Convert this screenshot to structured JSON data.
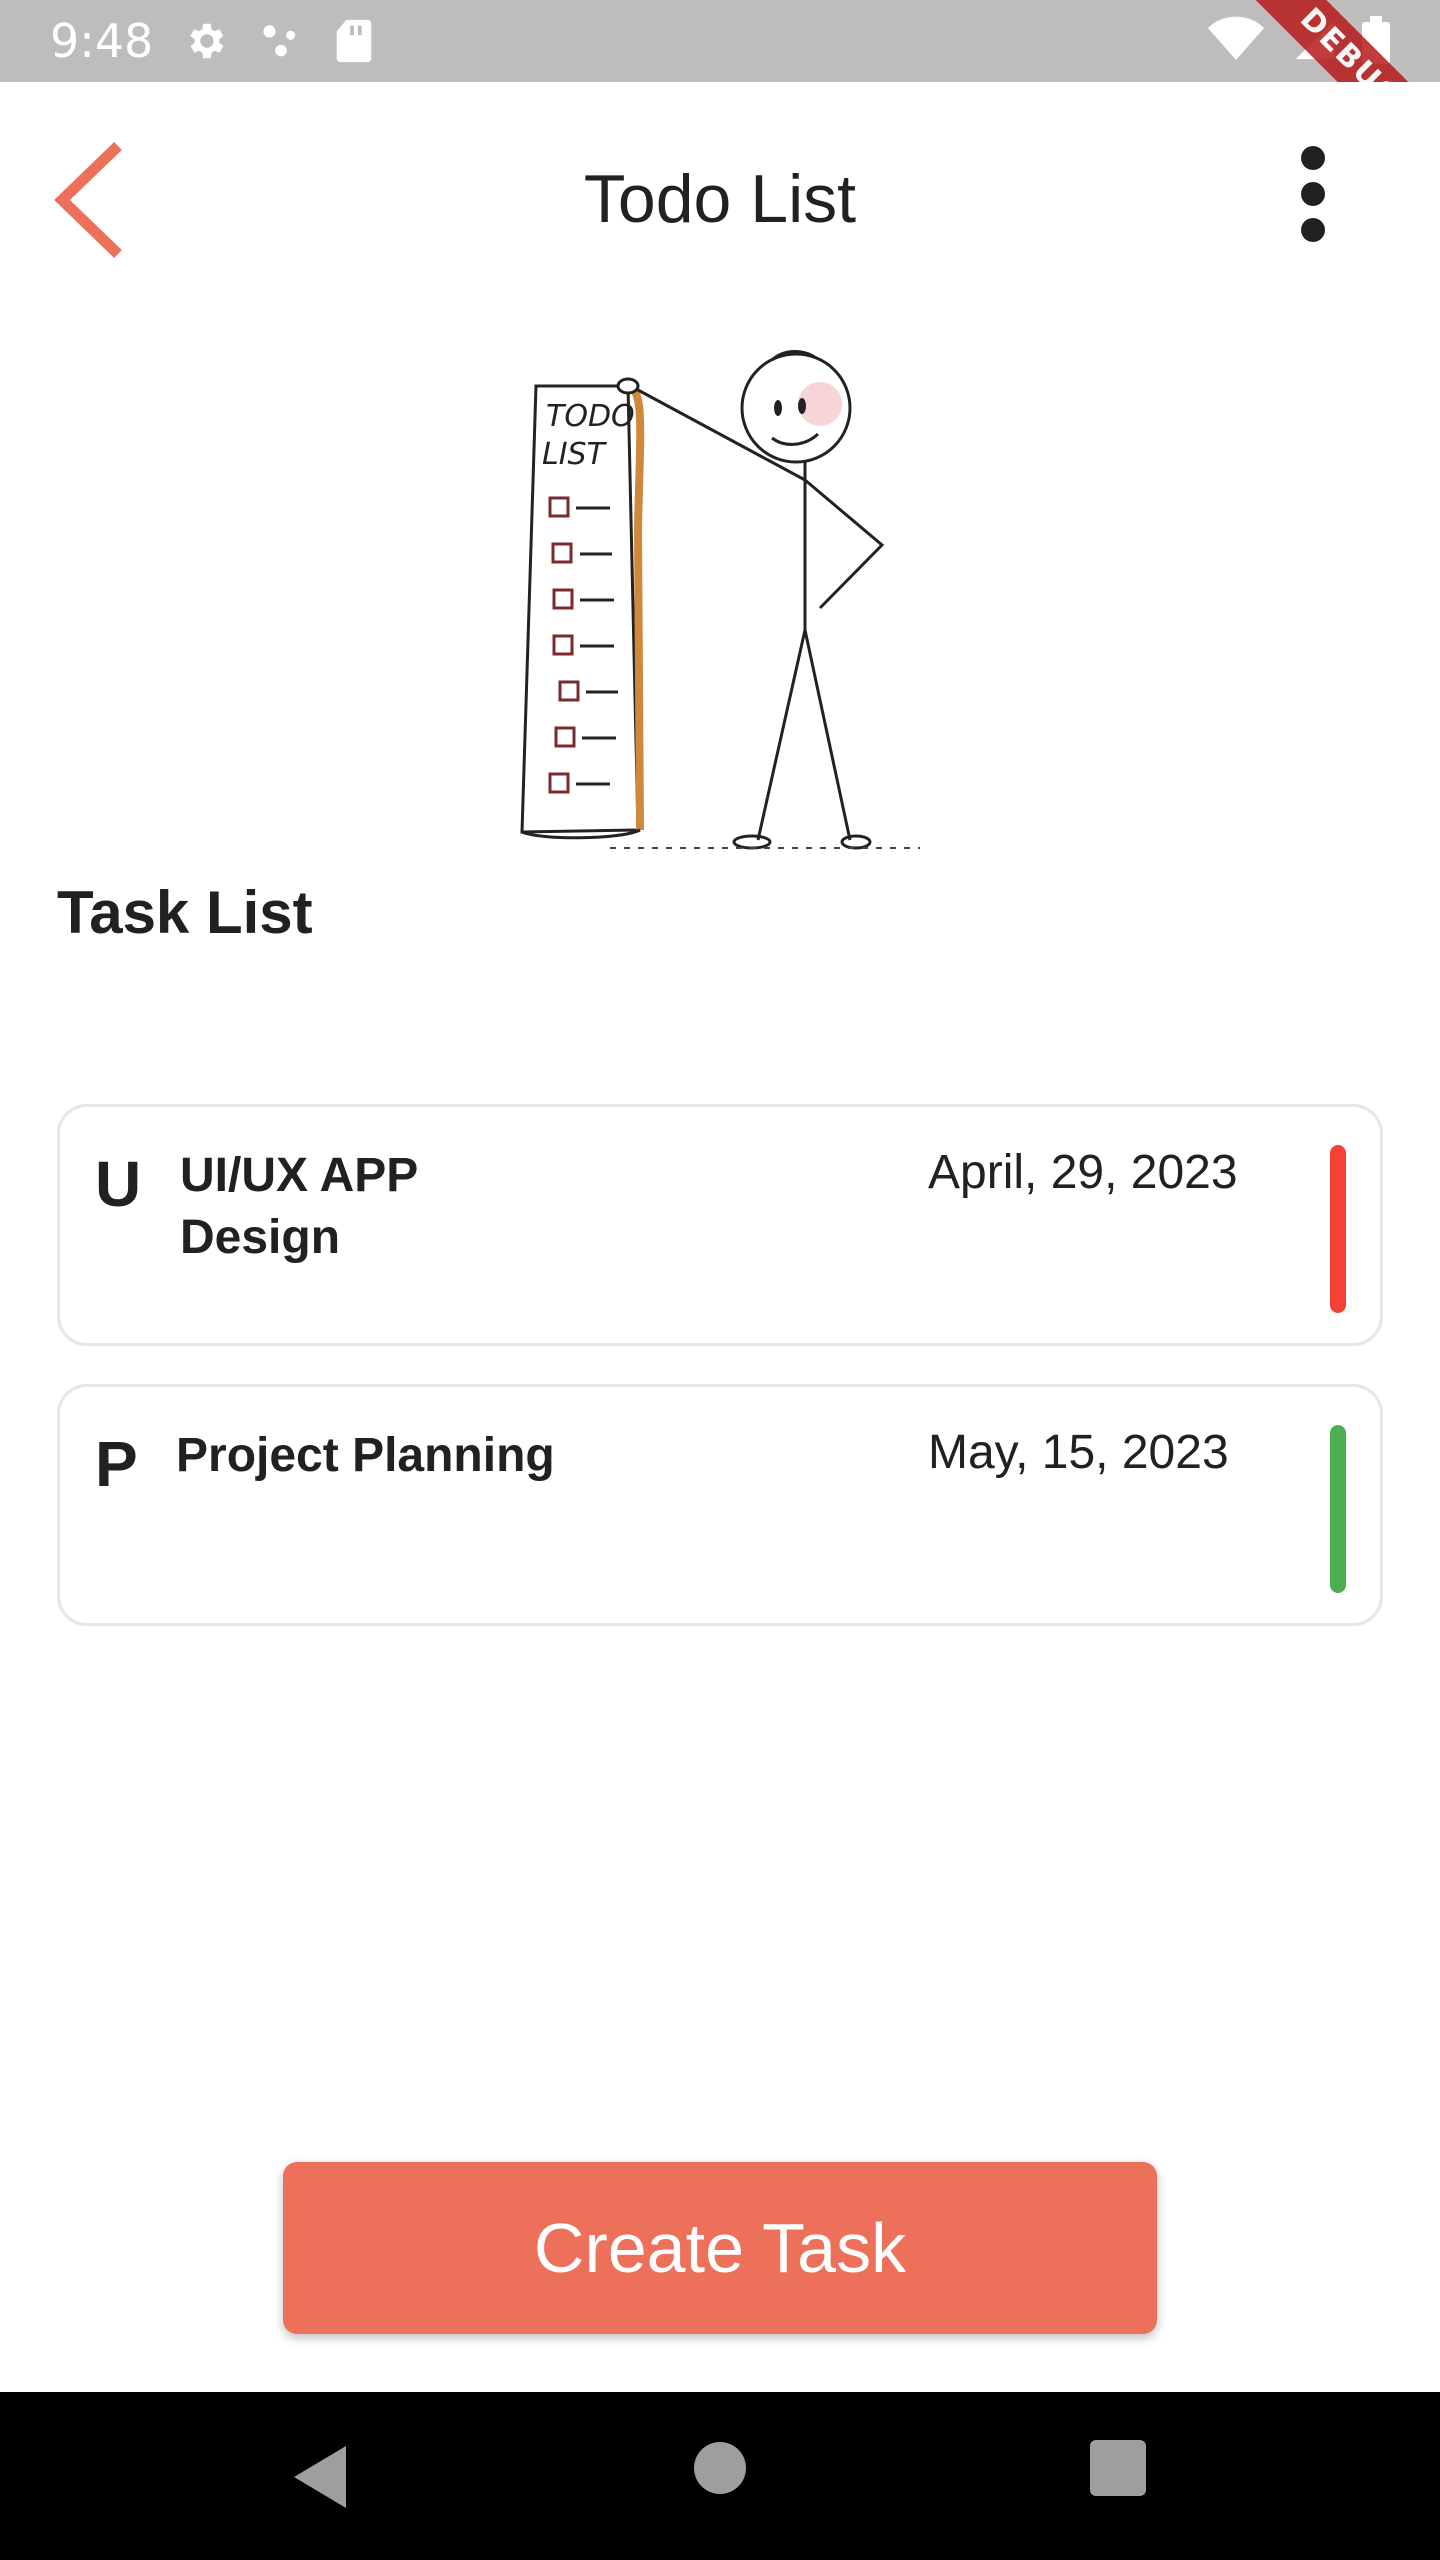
{
  "status_bar": {
    "time": "9:48",
    "icons": [
      "settings-icon",
      "dots-icon",
      "sd-card-icon",
      "wifi-icon",
      "signal-icon",
      "battery-icon"
    ],
    "debug_label": "DEBUG"
  },
  "app_bar": {
    "title": "Todo List",
    "back_icon": "chevron-left-icon",
    "menu_icon": "more-vertical-icon",
    "accent_color": "#ec705a"
  },
  "illustration": {
    "scroll_heading": [
      "TODO",
      "LIST"
    ]
  },
  "section": {
    "title": "Task List"
  },
  "tasks": [
    {
      "initial": "U",
      "title": "UI/UX APP Design",
      "date": "April, 29, 2023",
      "indicator_color": "#f44336"
    },
    {
      "initial": "P",
      "title": "Project Planning",
      "date": "May, 15, 2023",
      "indicator_color": "#4caf50"
    }
  ],
  "create_button": {
    "label": "Create Task",
    "color": "#ec705a"
  },
  "nav_bar": {
    "icons": [
      "nav-back-icon",
      "nav-home-icon",
      "nav-recents-icon"
    ]
  }
}
